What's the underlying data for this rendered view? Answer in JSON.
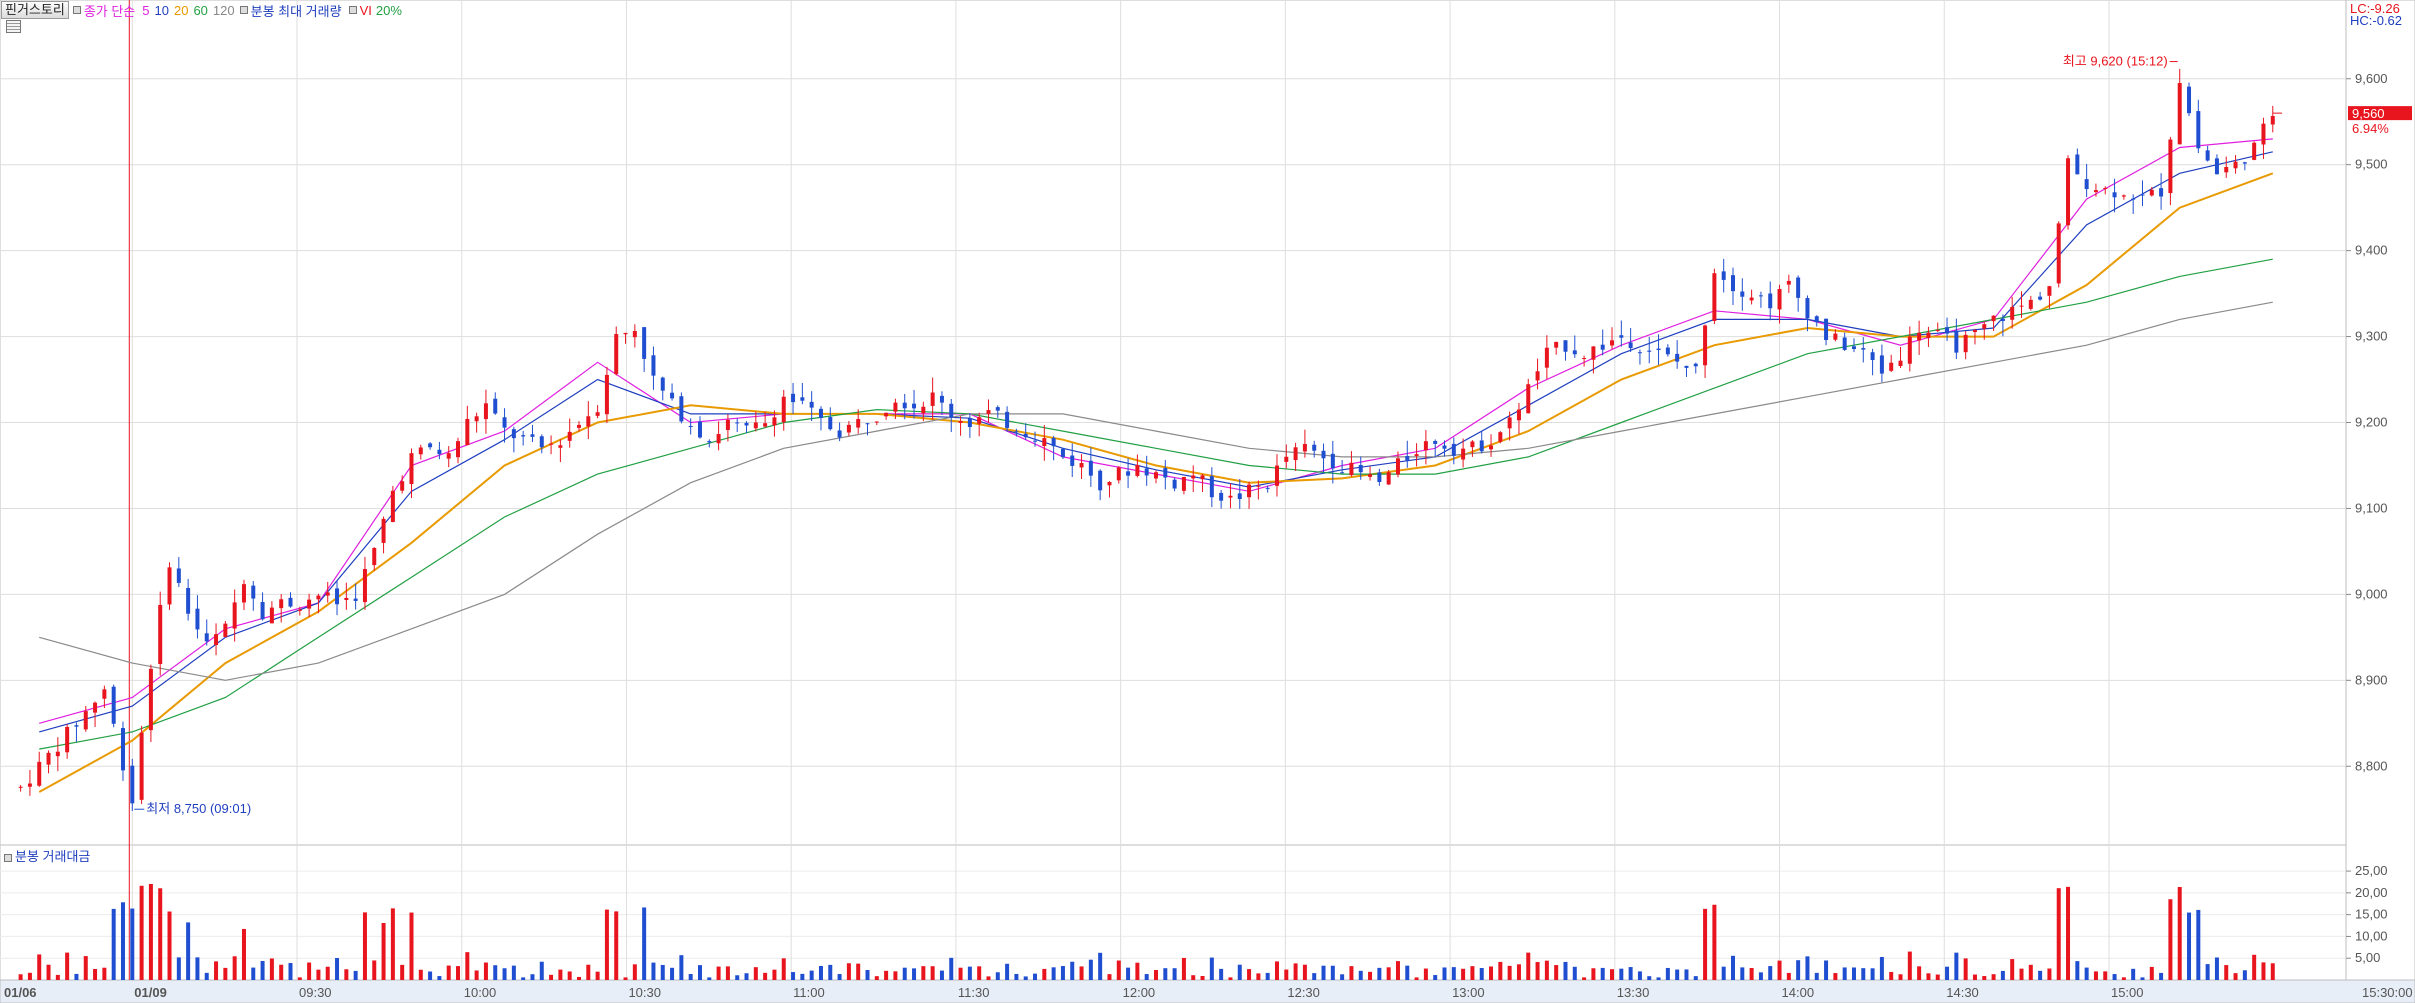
{
  "header": {
    "title_button": "핀거스토리",
    "ma_label": "종가 단순",
    "ma_periods": [
      {
        "label": "5",
        "color": "#e020e0"
      },
      {
        "label": "10",
        "color": "#1f3fbf"
      },
      {
        "label": "20",
        "color": "#e89a00"
      },
      {
        "label": "60",
        "color": "#22a044"
      },
      {
        "label": "120",
        "color": "#888888"
      }
    ],
    "max_volume_label": "분봉 최대 거래량",
    "vi_label": "VI",
    "vi_value": "20%"
  },
  "right_info": {
    "lc": "LC:-9.26",
    "hc": "HC:-0.62",
    "current_price": "9,560",
    "current_change": "6.94%"
  },
  "annotations": {
    "high": "최고 9,620 (15:12)",
    "low": "최저 8,750 (09:01)"
  },
  "volume_panel": {
    "title": "분봉 거래대금"
  },
  "colors": {
    "up": "#e8141e",
    "down": "#1f4fd0",
    "ma5": "#e020e0",
    "ma10": "#1f3fbf",
    "ma20": "#e89a00",
    "ma60": "#22a044",
    "ma120": "#8a8a8a",
    "grid": "#dedede"
  },
  "chart_data": {
    "type": "candlestick",
    "y_ticks": [
      "9,600",
      "9,500",
      "9,400",
      "9,300",
      "9,200",
      "9,100",
      "9,000",
      "8,900",
      "8,800"
    ],
    "y_tick_values": [
      9600,
      9500,
      9400,
      9300,
      9200,
      9100,
      9000,
      8900,
      8800
    ],
    "ylim": [
      8720,
      9680
    ],
    "volume_ticks": [
      "25,00",
      "20,00",
      "15,00",
      "10,00",
      "5,00"
    ],
    "volume_tick_values": [
      25,
      20,
      15,
      10,
      5
    ],
    "volume_ylim": [
      0,
      28
    ],
    "x_ticks": [
      "01/06",
      "01/09",
      "09:30",
      "10:00",
      "10:30",
      "11:00",
      "11:30",
      "12:00",
      "12:30",
      "13:00",
      "13:30",
      "14:00",
      "14:30",
      "15:00",
      "15:30:00"
    ],
    "x_tick_minutes": [
      -999,
      0,
      30,
      60,
      90,
      120,
      150,
      180,
      210,
      240,
      270,
      300,
      330,
      360,
      390
    ],
    "high": {
      "price": 9620,
      "time": "15:12"
    },
    "low": {
      "price": 8750,
      "time": "09:01"
    },
    "close": 9560,
    "change_pct": 6.94,
    "price_path": [
      [
        -10,
        8800
      ],
      [
        -6,
        8850
      ],
      [
        -3,
        8890
      ],
      [
        0,
        8760
      ],
      [
        2,
        8920
      ],
      [
        4,
        9040
      ],
      [
        6,
        8980
      ],
      [
        8,
        8940
      ],
      [
        10,
        8960
      ],
      [
        12,
        9020
      ],
      [
        14,
        8980
      ],
      [
        16,
        8990
      ],
      [
        18,
        8990
      ],
      [
        20,
        9000
      ],
      [
        22,
        8990
      ],
      [
        24,
        9000
      ],
      [
        26,
        9050
      ],
      [
        28,
        9120
      ],
      [
        30,
        9160
      ],
      [
        32,
        9170
      ],
      [
        34,
        9160
      ],
      [
        36,
        9200
      ],
      [
        38,
        9220
      ],
      [
        40,
        9190
      ],
      [
        42,
        9180
      ],
      [
        44,
        9170
      ],
      [
        46,
        9180
      ],
      [
        48,
        9200
      ],
      [
        50,
        9220
      ],
      [
        52,
        9300
      ],
      [
        54,
        9310
      ],
      [
        56,
        9250
      ],
      [
        58,
        9220
      ],
      [
        60,
        9200
      ],
      [
        62,
        9180
      ],
      [
        64,
        9200
      ],
      [
        66,
        9190
      ],
      [
        68,
        9200
      ],
      [
        70,
        9230
      ],
      [
        72,
        9220
      ],
      [
        74,
        9200
      ],
      [
        76,
        9190
      ],
      [
        78,
        9200
      ],
      [
        80,
        9210
      ],
      [
        82,
        9230
      ],
      [
        84,
        9220
      ],
      [
        86,
        9230
      ],
      [
        88,
        9210
      ],
      [
        90,
        9200
      ],
      [
        92,
        9210
      ],
      [
        94,
        9200
      ],
      [
        96,
        9190
      ],
      [
        98,
        9180
      ],
      [
        100,
        9160
      ],
      [
        102,
        9150
      ],
      [
        104,
        9130
      ],
      [
        106,
        9140
      ],
      [
        108,
        9150
      ],
      [
        110,
        9140
      ],
      [
        112,
        9130
      ],
      [
        114,
        9140
      ],
      [
        116,
        9120
      ],
      [
        118,
        9110
      ],
      [
        120,
        9120
      ],
      [
        122,
        9130
      ],
      [
        124,
        9160
      ],
      [
        126,
        9170
      ],
      [
        128,
        9160
      ],
      [
        130,
        9150
      ],
      [
        132,
        9140
      ],
      [
        134,
        9130
      ],
      [
        136,
        9150
      ],
      [
        138,
        9170
      ],
      [
        140,
        9180
      ],
      [
        142,
        9170
      ],
      [
        144,
        9170
      ],
      [
        146,
        9180
      ],
      [
        148,
        9200
      ],
      [
        150,
        9240
      ],
      [
        152,
        9280
      ],
      [
        154,
        9290
      ],
      [
        156,
        9280
      ],
      [
        158,
        9290
      ],
      [
        160,
        9300
      ],
      [
        162,
        9290
      ],
      [
        164,
        9280
      ],
      [
        166,
        9270
      ],
      [
        168,
        9260
      ],
      [
        170,
        9380
      ],
      [
        172,
        9360
      ],
      [
        174,
        9350
      ],
      [
        176,
        9340
      ],
      [
        178,
        9360
      ],
      [
        180,
        9330
      ],
      [
        182,
        9300
      ],
      [
        184,
        9290
      ],
      [
        186,
        9280
      ],
      [
        188,
        9260
      ],
      [
        190,
        9280
      ],
      [
        192,
        9310
      ],
      [
        194,
        9300
      ],
      [
        196,
        9290
      ],
      [
        198,
        9300
      ],
      [
        200,
        9320
      ],
      [
        202,
        9330
      ],
      [
        204,
        9340
      ],
      [
        206,
        9360
      ],
      [
        208,
        9500
      ],
      [
        210,
        9480
      ],
      [
        212,
        9470
      ],
      [
        214,
        9470
      ],
      [
        216,
        9460
      ],
      [
        218,
        9470
      ],
      [
        220,
        9600
      ],
      [
        222,
        9520
      ],
      [
        224,
        9490
      ],
      [
        226,
        9500
      ],
      [
        228,
        9520
      ],
      [
        230,
        9560
      ]
    ],
    "series": [
      {
        "name": "5",
        "values": [
          [
            -10,
            8850
          ],
          [
            0,
            8880
          ],
          [
            10,
            8960
          ],
          [
            20,
            8990
          ],
          [
            30,
            9150
          ],
          [
            40,
            9190
          ],
          [
            50,
            9270
          ],
          [
            60,
            9200
          ],
          [
            70,
            9210
          ],
          [
            80,
            9210
          ],
          [
            90,
            9210
          ],
          [
            100,
            9160
          ],
          [
            110,
            9140
          ],
          [
            120,
            9120
          ],
          [
            130,
            9150
          ],
          [
            140,
            9170
          ],
          [
            150,
            9240
          ],
          [
            160,
            9290
          ],
          [
            170,
            9330
          ],
          [
            180,
            9320
          ],
          [
            190,
            9290
          ],
          [
            200,
            9320
          ],
          [
            210,
            9460
          ],
          [
            220,
            9520
          ],
          [
            230,
            9530
          ]
        ]
      },
      {
        "name": "10",
        "values": [
          [
            -10,
            8840
          ],
          [
            0,
            8870
          ],
          [
            10,
            8950
          ],
          [
            20,
            8990
          ],
          [
            30,
            9120
          ],
          [
            40,
            9180
          ],
          [
            50,
            9250
          ],
          [
            60,
            9210
          ],
          [
            70,
            9210
          ],
          [
            80,
            9210
          ],
          [
            90,
            9205
          ],
          [
            100,
            9170
          ],
          [
            110,
            9145
          ],
          [
            120,
            9125
          ],
          [
            130,
            9145
          ],
          [
            140,
            9160
          ],
          [
            150,
            9220
          ],
          [
            160,
            9280
          ],
          [
            170,
            9320
          ],
          [
            180,
            9320
          ],
          [
            190,
            9300
          ],
          [
            200,
            9310
          ],
          [
            210,
            9430
          ],
          [
            220,
            9490
          ],
          [
            230,
            9515
          ]
        ]
      },
      {
        "name": "20",
        "values": [
          [
            -10,
            8770
          ],
          [
            0,
            8830
          ],
          [
            10,
            8920
          ],
          [
            20,
            8980
          ],
          [
            30,
            9060
          ],
          [
            40,
            9150
          ],
          [
            50,
            9200
          ],
          [
            60,
            9220
          ],
          [
            70,
            9210
          ],
          [
            80,
            9210
          ],
          [
            90,
            9200
          ],
          [
            100,
            9180
          ],
          [
            110,
            9150
          ],
          [
            120,
            9130
          ],
          [
            130,
            9135
          ],
          [
            140,
            9150
          ],
          [
            150,
            9190
          ],
          [
            160,
            9250
          ],
          [
            170,
            9290
          ],
          [
            180,
            9310
          ],
          [
            190,
            9300
          ],
          [
            200,
            9300
          ],
          [
            210,
            9360
          ],
          [
            220,
            9450
          ],
          [
            230,
            9490
          ]
        ]
      },
      {
        "name": "60",
        "values": [
          [
            -10,
            8820
          ],
          [
            0,
            8840
          ],
          [
            10,
            8880
          ],
          [
            20,
            8950
          ],
          [
            30,
            9020
          ],
          [
            40,
            9090
          ],
          [
            50,
            9140
          ],
          [
            60,
            9170
          ],
          [
            70,
            9200
          ],
          [
            80,
            9215
          ],
          [
            90,
            9210
          ],
          [
            100,
            9190
          ],
          [
            110,
            9170
          ],
          [
            120,
            9150
          ],
          [
            130,
            9140
          ],
          [
            140,
            9140
          ],
          [
            150,
            9160
          ],
          [
            160,
            9200
          ],
          [
            170,
            9240
          ],
          [
            180,
            9280
          ],
          [
            190,
            9300
          ],
          [
            200,
            9320
          ],
          [
            210,
            9340
          ],
          [
            220,
            9370
          ],
          [
            230,
            9390
          ]
        ]
      },
      {
        "name": "120",
        "values": [
          [
            -10,
            8950
          ],
          [
            0,
            8920
          ],
          [
            10,
            8900
          ],
          [
            20,
            8920
          ],
          [
            30,
            8960
          ],
          [
            40,
            9000
          ],
          [
            50,
            9070
          ],
          [
            60,
            9130
          ],
          [
            70,
            9170
          ],
          [
            80,
            9190
          ],
          [
            90,
            9210
          ],
          [
            100,
            9210
          ],
          [
            110,
            9190
          ],
          [
            120,
            9170
          ],
          [
            130,
            9160
          ],
          [
            140,
            9160
          ],
          [
            150,
            9170
          ],
          [
            160,
            9190
          ],
          [
            170,
            9210
          ],
          [
            180,
            9230
          ],
          [
            190,
            9250
          ],
          [
            200,
            9270
          ],
          [
            210,
            9290
          ],
          [
            220,
            9320
          ],
          [
            230,
            9340
          ]
        ]
      }
    ]
  }
}
